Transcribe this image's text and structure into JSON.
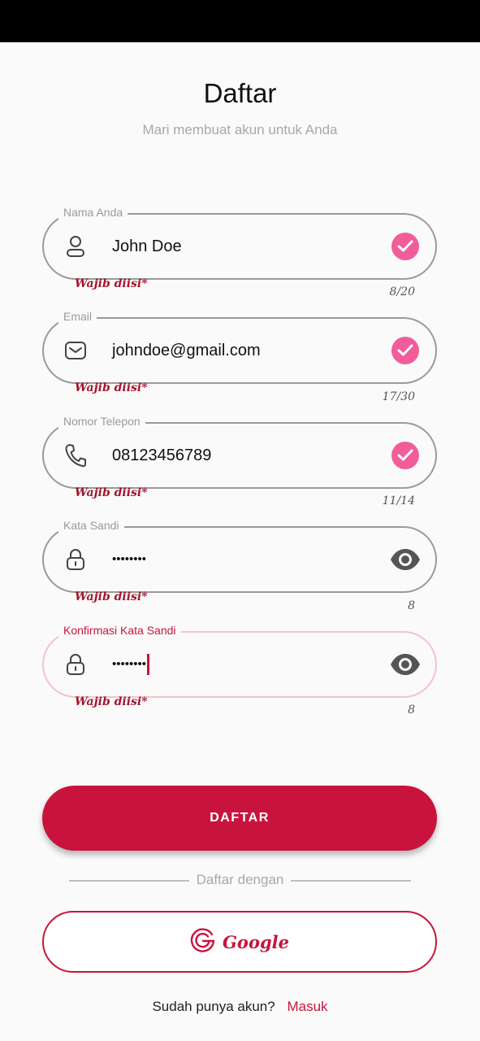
{
  "header": {
    "title": "Daftar",
    "subtitle": "Mari membuat akun untuk Anda"
  },
  "fields": [
    {
      "label": "Nama Anda",
      "value": "John Doe",
      "hint": "Wajib diisi*",
      "counter": "8/20",
      "icon": "person-icon",
      "trailing": "check-icon"
    },
    {
      "label": "Email",
      "value": "johndoe@gmail.com",
      "hint": "Wajib diisi*",
      "counter": "17/30",
      "icon": "mail-icon",
      "trailing": "check-icon"
    },
    {
      "label": "Nomor Telepon",
      "value": "08123456789",
      "hint": "Wajib diisi*",
      "counter": "11/14",
      "icon": "phone-icon",
      "trailing": "check-icon"
    },
    {
      "label": "Kata Sandi",
      "value": "••••••••",
      "hint": "Wajib diisi*",
      "counter": "8",
      "icon": "lock-icon",
      "trailing": "eye-icon"
    },
    {
      "label": "Konfirmasi Kata Sandi",
      "value": "••••••••",
      "hint": "Wajib diisi*",
      "counter": "8",
      "icon": "lock-icon",
      "trailing": "eye-icon",
      "focused": true
    }
  ],
  "submit_label": "DAFTAR",
  "divider_text": "Daftar dengan",
  "google_label": "Google",
  "footer": {
    "prompt": "Sudah punya akun?",
    "link": "Masuk"
  },
  "colors": {
    "primary": "#c8143c",
    "check": "#f25c9a",
    "border": "#9a9a9a",
    "focused_border": "#f2c4cd",
    "background": "#fafafa"
  }
}
